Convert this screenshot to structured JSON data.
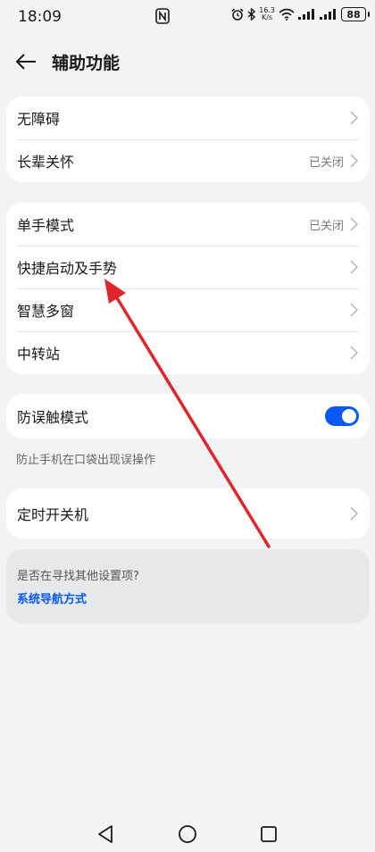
{
  "status_bar": {
    "time": "18:09",
    "net_speed_value": "16.3",
    "net_speed_unit": "K/s",
    "battery": "88"
  },
  "header": {
    "title": "辅助功能"
  },
  "group1": [
    {
      "label": "无障碍",
      "value": ""
    },
    {
      "label": "长辈关怀",
      "value": "已关闭"
    }
  ],
  "group2": [
    {
      "label": "单手模式",
      "value": "已关闭"
    },
    {
      "label": "快捷启动及手势",
      "value": ""
    },
    {
      "label": "智慧多窗",
      "value": ""
    },
    {
      "label": "中转站",
      "value": ""
    }
  ],
  "toggle_item": {
    "label": "防误触模式",
    "on": true,
    "hint": "防止手机在口袋出现误操作"
  },
  "timer_item": {
    "label": "定时开关机"
  },
  "suggestion": {
    "question": "是否在寻找其他设置项?",
    "link": "系统导航方式"
  },
  "colors": {
    "accent": "#0a59f7",
    "annotation_arrow": "#e0262c",
    "background": "#f1f3f5"
  }
}
